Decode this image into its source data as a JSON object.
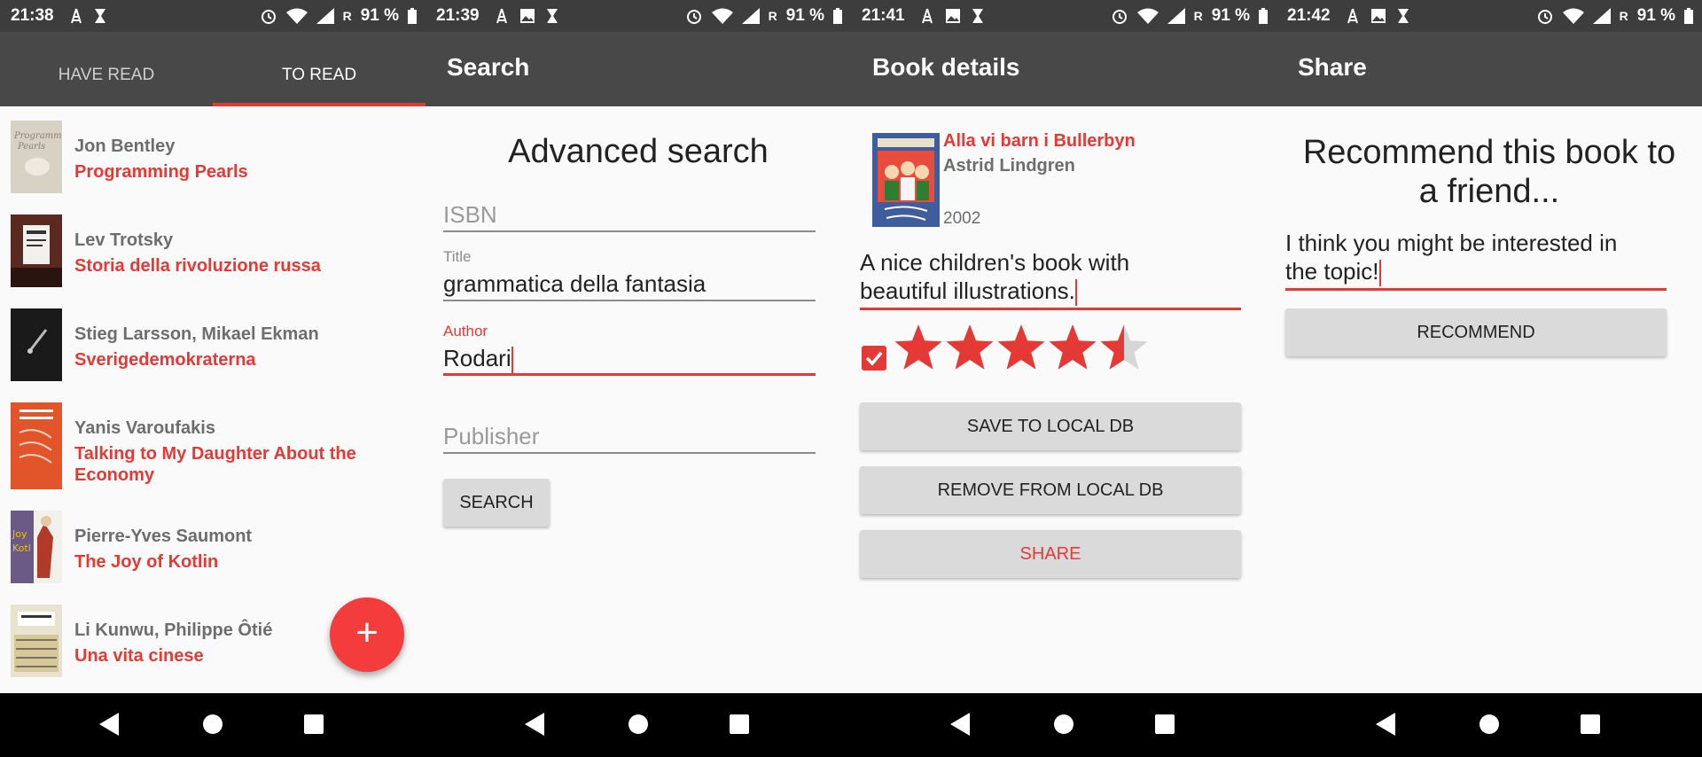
{
  "status_bars": [
    {
      "time": "21:38",
      "battery": "91 %",
      "roaming": "R"
    },
    {
      "time": "21:39",
      "battery": "91 %",
      "roaming": "R"
    },
    {
      "time": "21:41",
      "battery": "91 %",
      "roaming": "R"
    },
    {
      "time": "21:42",
      "battery": "91 %",
      "roaming": "R"
    }
  ],
  "screen1": {
    "tabs": [
      {
        "label": "HAVE READ",
        "active": false
      },
      {
        "label": "TO READ",
        "active": true
      }
    ],
    "books": [
      {
        "author": "Jon Bentley",
        "title": "Programming Pearls",
        "cover_color": "#d8d2c4"
      },
      {
        "author": "Lev Trotsky",
        "title": "Storia della rivoluzione russa",
        "cover_color": "#5a2a20"
      },
      {
        "author": "Stieg Larsson, Mikael Ekman",
        "title": "Sverigedemokraterna",
        "cover_color": "#1a1a1a"
      },
      {
        "author": "Yanis Varoufakis",
        "title": "Talking to My Daughter About the Economy",
        "cover_color": "#e2552a"
      },
      {
        "author": "Pierre-Yves Saumont",
        "title": "The Joy of Kotlin",
        "cover_color": "#6b5a86"
      },
      {
        "author": "Li Kunwu, Philippe Ôtié",
        "title": "Una vita cinese",
        "cover_color": "#e8e2d0"
      }
    ],
    "fab_symbol": "+"
  },
  "screen2": {
    "appbar_title": "Search",
    "heading": "Advanced search",
    "isbn_placeholder": "ISBN",
    "title_label": "Title",
    "title_value": "grammatica della fantasia",
    "author_label": "Author",
    "author_value": "Rodari",
    "publisher_placeholder": "Publisher",
    "search_button": "SEARCH"
  },
  "screen3": {
    "appbar_title": "Book details",
    "book_title": "Alla vi barn i Bullerbyn",
    "book_author": "Astrid Lindgren",
    "book_year": "2002",
    "review_text_line1": "A nice children's book with",
    "review_text_line2": "beautiful illustrations.",
    "rating": 4.5,
    "rating_max": 5,
    "have_read_checked": true,
    "save_button": "SAVE TO LOCAL DB",
    "remove_button": "REMOVE FROM LOCAL DB",
    "share_button": "SHARE"
  },
  "screen4": {
    "appbar_title": "Share",
    "heading_line1": "Recommend this book to",
    "heading_line2": "a friend...",
    "message_line1": "I think you might be interested in",
    "message_line2": "the topic!",
    "recommend_button": "RECOMMEND"
  },
  "colors": {
    "accent": "#e53935",
    "appbar": "#484848",
    "statusbar": "#3d3d3d",
    "button": "#dadada"
  }
}
